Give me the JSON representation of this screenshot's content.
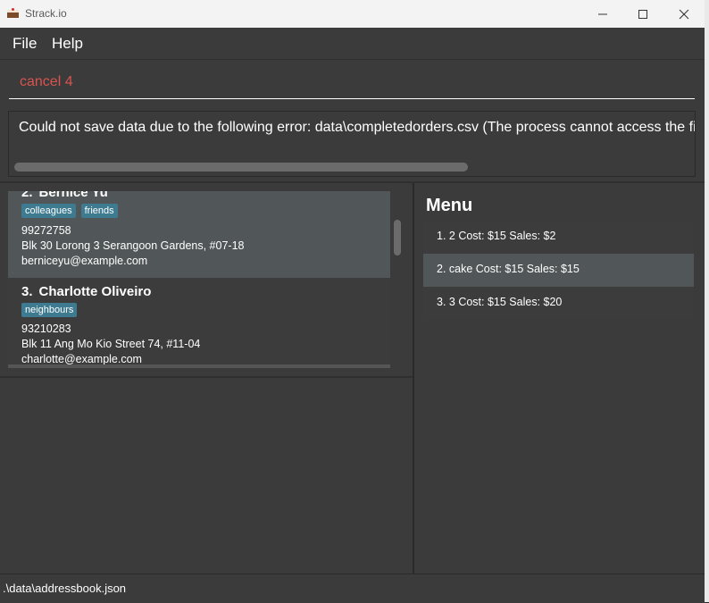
{
  "window": {
    "title": "Strack.io"
  },
  "menubar": {
    "file": "File",
    "help": "Help"
  },
  "command": {
    "value": "cancel 4"
  },
  "result": {
    "text": "Could not save data due to the following error: data\\completedorders.csv (The process cannot access the file because it is being used by another process)"
  },
  "persons": [
    {
      "index": "2.",
      "name": "Bernice Yu",
      "tags": [
        "colleagues",
        "friends"
      ],
      "phone": "99272758",
      "address": "Blk 30 Lorong 3 Serangoon Gardens, #07-18",
      "email": "berniceyu@example.com"
    },
    {
      "index": "3.",
      "name": "Charlotte Oliveiro",
      "tags": [
        "neighbours"
      ],
      "phone": "93210283",
      "address": "Blk 11 Ang Mo Kio Street 74, #11-04",
      "email": "charlotte@example.com"
    }
  ],
  "menu": {
    "title": "Menu",
    "items": [
      {
        "text": "1. 2  Cost: $15  Sales: $2"
      },
      {
        "text": "2. cake  Cost: $15  Sales: $15"
      },
      {
        "text": "3. 3  Cost: $15  Sales: $20"
      }
    ]
  },
  "status": {
    "path": ".\\data\\addressbook.json"
  }
}
